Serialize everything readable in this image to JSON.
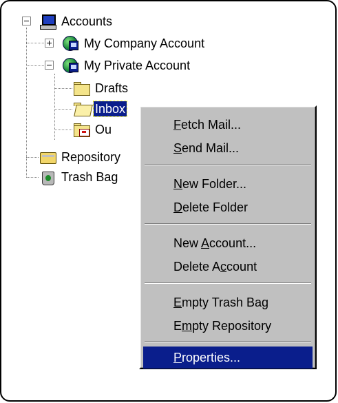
{
  "tree": {
    "root": "Accounts",
    "accounts": [
      {
        "label": "My Company Account",
        "expanded": false
      },
      {
        "label": "My Private Account",
        "expanded": true
      }
    ],
    "folders": [
      {
        "label": "Drafts"
      },
      {
        "label": "Inbox",
        "selected": true
      },
      {
        "label": "Ou"
      }
    ],
    "repository": "Repository",
    "trash": "Trash Bag"
  },
  "context_menu": {
    "items": [
      {
        "pre": "",
        "key": "F",
        "post": "etch Mail..."
      },
      {
        "pre": "",
        "key": "S",
        "post": "end Mail..."
      },
      {
        "pre": "",
        "key": "N",
        "post": "ew Folder..."
      },
      {
        "pre": "",
        "key": "D",
        "post": "elete Folder"
      },
      {
        "pre": "New ",
        "key": "A",
        "post": "ccount..."
      },
      {
        "pre": "Delete A",
        "key": "c",
        "post": "count"
      },
      {
        "pre": "",
        "key": "E",
        "post": "mpty Trash Bag"
      },
      {
        "pre": "E",
        "key": "m",
        "post": "pty Repository"
      },
      {
        "pre": "",
        "key": "P",
        "post": "roperties...",
        "highlighted": true
      }
    ]
  },
  "colors": {
    "selection": "#0a1e8c",
    "menu_background": "#c0c0c0"
  }
}
